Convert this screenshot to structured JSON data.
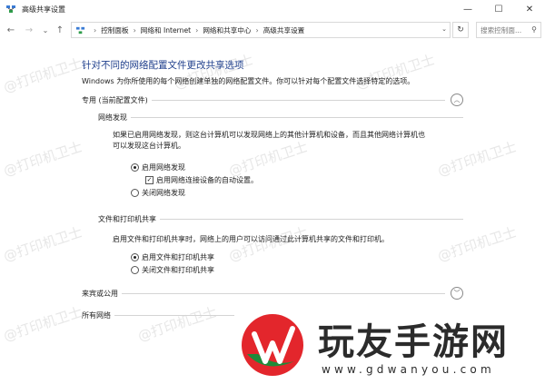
{
  "window": {
    "title": "高级共享设置",
    "minimize": "—",
    "maximize": "☐",
    "close": "✕"
  },
  "nav": {
    "back": "←",
    "forward": "→",
    "dropdown": "⌄",
    "up": "↑",
    "breadcrumbs": [
      "控制面板",
      "网络和 Internet",
      "网络和共享中心",
      "高级共享设置"
    ],
    "refresh": "↻",
    "search_placeholder": "搜索控制面..."
  },
  "main": {
    "heading": "针对不同的网络配置文件更改共享选项",
    "description": "Windows 为你所使用的每个网络创建单独的网络配置文件。你可以针对每个配置文件选择特定的选项。",
    "profiles": [
      {
        "label": "专用 (当前配置文件)",
        "expanded": true,
        "sections": [
          {
            "title": "网络发现",
            "text_line1": "如果已启用网络发现，则这台计算机可以发现网络上的其他计算机和设备，而且其他网络计算机也",
            "text_line2": "可以发现这台计算机。",
            "options": [
              {
                "type": "radio",
                "label": "启用网络发现",
                "selected": true
              },
              {
                "type": "checkbox",
                "label": "启用网络连接设备的自动设置。",
                "checked": true
              },
              {
                "type": "radio",
                "label": "关闭网络发现",
                "selected": false
              }
            ]
          },
          {
            "title": "文件和打印机共享",
            "text_line1": "启用文件和打印机共享时，网络上的用户可以访问通过此计算机共享的文件和打印机。",
            "options": [
              {
                "type": "radio",
                "label": "启用文件和打印机共享",
                "selected": true
              },
              {
                "type": "radio",
                "label": "关闭文件和打印机共享",
                "selected": false
              }
            ]
          }
        ]
      },
      {
        "label": "来宾或公用",
        "expanded": false
      },
      {
        "label": "所有网络",
        "expanded": false
      }
    ]
  },
  "watermark": "@打印机卫士",
  "promo": {
    "title": "玩友手游网",
    "url": "www.gdwanyou.com"
  },
  "colors": {
    "heading": "#1f3f8c",
    "promo_red": "#e3262c",
    "promo_green": "#1f8a3a"
  }
}
